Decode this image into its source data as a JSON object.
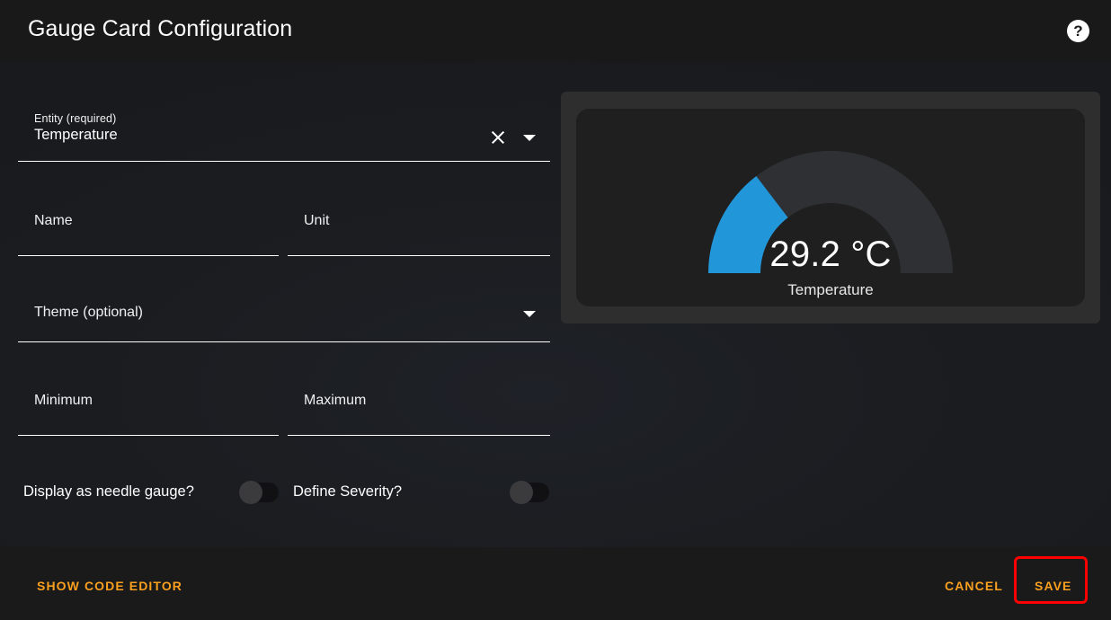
{
  "header": {
    "title": "Gauge Card Configuration",
    "help_icon": "help-circle-icon",
    "help_glyph": "?"
  },
  "form": {
    "entity": {
      "label": "Entity (required)",
      "value": "Temperature",
      "clear_icon": "close-icon",
      "dropdown_icon": "caret-down-icon"
    },
    "name": {
      "placeholder": "Name",
      "value": ""
    },
    "unit": {
      "placeholder": "Unit",
      "value": ""
    },
    "theme": {
      "placeholder": "Theme (optional)",
      "value": "",
      "dropdown_icon": "caret-down-icon"
    },
    "minimum": {
      "placeholder": "Minimum",
      "value": ""
    },
    "maximum": {
      "placeholder": "Maximum",
      "value": ""
    },
    "needle_toggle": {
      "label": "Display as needle gauge?",
      "state": "off"
    },
    "severity_toggle": {
      "label": "Define Severity?",
      "state": "off"
    }
  },
  "preview": {
    "gauge": {
      "value_text": "29.2 °C",
      "name": "Temperature",
      "value": 29.2,
      "min": 0,
      "max": 100,
      "unit": "°C",
      "fill_color": "#2196d9",
      "track_color": "#2f3033",
      "card_background": "#1f1f1f"
    }
  },
  "footer": {
    "show_code_editor": "SHOW CODE EDITOR",
    "cancel": "CANCEL",
    "save": "SAVE"
  },
  "annotation": {
    "highlight_target": "save-button",
    "color": "#fe0000"
  },
  "colors": {
    "accent": "#fa9f1e",
    "gauge_blue": "#2196d9",
    "dialog_background": "#1a1a1a",
    "body_background": "#1b1d21"
  }
}
